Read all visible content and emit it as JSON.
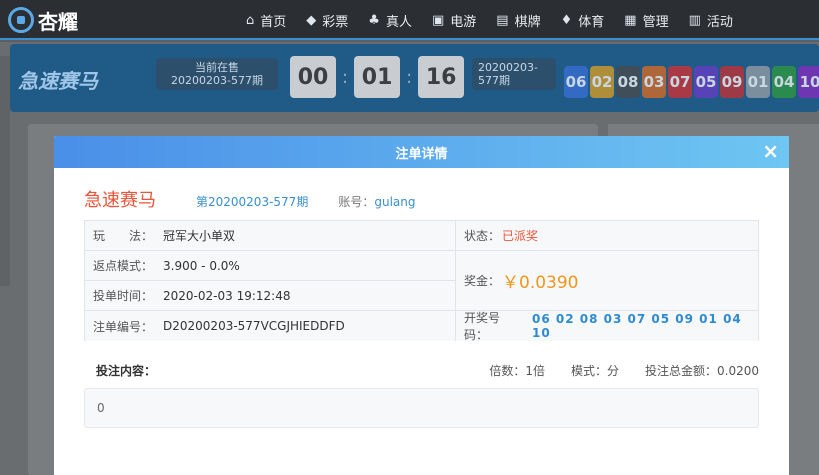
{
  "nav": {
    "logo_text": "杏耀",
    "items": [
      {
        "icon": "home-icon",
        "glyph": "⌂",
        "label": "首页"
      },
      {
        "icon": "lottery-icon",
        "glyph": "◆",
        "label": "彩票"
      },
      {
        "icon": "live-icon",
        "glyph": "♣",
        "label": "真人"
      },
      {
        "icon": "slots-icon",
        "glyph": "▣",
        "label": "电游"
      },
      {
        "icon": "cards-icon",
        "glyph": "▤",
        "label": "棋牌"
      },
      {
        "icon": "sports-icon",
        "glyph": "♦",
        "label": "体育"
      },
      {
        "icon": "manage-icon",
        "glyph": "▦",
        "label": "管理"
      },
      {
        "icon": "promo-icon",
        "glyph": "▥",
        "label": "活动"
      }
    ]
  },
  "game_header": {
    "current_label": "当前在售",
    "current_issue": "20200203-577期",
    "timer": {
      "h": "00",
      "m": "01",
      "s": "16"
    },
    "last_issue_line1": "20200203-",
    "last_issue_line2": "577期",
    "balls": [
      {
        "n": "06",
        "color": "#3a6fd8"
      },
      {
        "n": "02",
        "color": "#e0a020"
      },
      {
        "n": "08",
        "color": "#4a4a4a"
      },
      {
        "n": "03",
        "color": "#e06a20"
      },
      {
        "n": "07",
        "color": "#d83030"
      },
      {
        "n": "05",
        "color": "#6a3ac8"
      },
      {
        "n": "09",
        "color": "#c83030"
      },
      {
        "n": "01",
        "color": "#9aa0a6"
      },
      {
        "n": "04",
        "color": "#2f9a3a"
      },
      {
        "n": "10",
        "color": "#8a2ac0"
      }
    ]
  },
  "modal": {
    "title": "注单详情",
    "close": "×",
    "game_name": "急速赛马",
    "issue": "第20200203-577期",
    "account_label": "账号：",
    "account": "gulang",
    "play_label": "玩　　法：",
    "play": "冠军大小单双",
    "rebate_label": "返点模式：",
    "rebate": "3.900 - 0.0%",
    "time_label": "投单时间：",
    "time": "2020-02-03 19:12:48",
    "order_label": "注单编号：",
    "order": "D20200203-577VCGJHIEDDFD",
    "status_label": "状态：",
    "status": "已派奖",
    "prize_label": "奖金：",
    "prize": "￥0.0390",
    "draw_label": "开奖号码：",
    "draw": "06 02 08 03 07 05 09 01 04 10",
    "content_label": "投注内容：",
    "multiple": "倍数：1倍",
    "mode": "模式：分",
    "total": "投注总金额：0.0200",
    "content_value": "0"
  }
}
